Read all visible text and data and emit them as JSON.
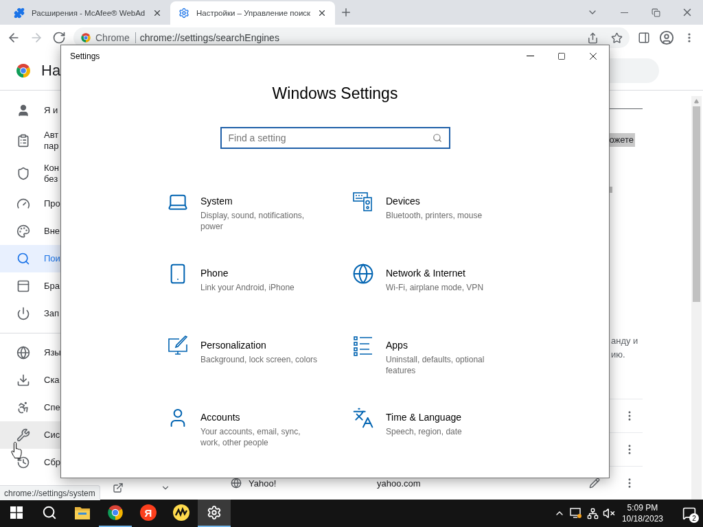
{
  "browser": {
    "tabs": [
      {
        "kind": "puzzle",
        "title": "Расширения - McAfee® WebAd",
        "selected": false
      },
      {
        "kind": "gear",
        "title": "Настройки – Управление поиск",
        "selected": true
      }
    ],
    "nav": [
      {
        "kind": "back",
        "disabled": false
      },
      {
        "kind": "forward",
        "disabled": true
      },
      {
        "kind": "reload",
        "disabled": false
      }
    ],
    "omnibox": {
      "chip": "Chrome",
      "url": "chrome://settings/searchEngines"
    }
  },
  "page": {
    "header_title": "На",
    "sidebar": [
      {
        "items": [
          {
            "kind": "person",
            "lines": [
              "Я и"
            ],
            "selected": false,
            "hovered": false
          },
          {
            "kind": "clipboard",
            "lines": [
              "Авт",
              "пар"
            ],
            "selected": false,
            "hovered": false
          },
          {
            "kind": "shield",
            "lines": [
              "Кон",
              "без"
            ],
            "selected": false,
            "hovered": false
          },
          {
            "kind": "gauge",
            "lines": [
              "Про"
            ],
            "selected": false,
            "hovered": false
          },
          {
            "kind": "palette",
            "lines": [
              "Вне"
            ],
            "selected": false,
            "hovered": false
          },
          {
            "kind": "search",
            "lines": [
              "Пои"
            ],
            "selected": true,
            "hovered": false
          },
          {
            "kind": "browser",
            "lines": [
              "Бра"
            ],
            "selected": false,
            "hovered": false
          },
          {
            "kind": "power",
            "lines": [
              "Зап"
            ],
            "selected": false,
            "hovered": false
          }
        ]
      },
      {
        "items": [
          {
            "kind": "globe",
            "lines": [
              "Язы"
            ],
            "selected": false,
            "hovered": false
          },
          {
            "kind": "download",
            "lines": [
              "Ска"
            ],
            "selected": false,
            "hovered": false
          },
          {
            "kind": "accessibility",
            "lines": [
              "Спе"
            ],
            "selected": false,
            "hovered": false
          },
          {
            "kind": "wrench",
            "lines": [
              "Сис"
            ],
            "selected": false,
            "hovered": true
          },
          {
            "kind": "history",
            "lines": [
              "Сбр"
            ],
            "selected": false,
            "hovered": false
          }
        ]
      }
    ],
    "highlight": "ожете",
    "paragraph_lines": [
      "анду и",
      "ию."
    ],
    "engines": [
      {
        "name": "Yahoo!",
        "keyword": "yahoo.com"
      }
    ],
    "status_url": "chrome://settings/system"
  },
  "settings_window": {
    "title": "Settings",
    "heading": "Windows Settings",
    "search_placeholder": "Find a setting",
    "categories": [
      {
        "kind": "laptop",
        "title": "System",
        "description": "Display, sound, notifications, power"
      },
      {
        "kind": "devices",
        "title": "Devices",
        "description": "Bluetooth, printers, mouse"
      },
      {
        "kind": "phone",
        "title": "Phone",
        "description": "Link your Android, iPhone"
      },
      {
        "kind": "globe",
        "title": "Network & Internet",
        "description": "Wi-Fi, airplane mode, VPN"
      },
      {
        "kind": "personalization",
        "title": "Personalization",
        "description": "Background, lock screen, colors"
      },
      {
        "kind": "apps",
        "title": "Apps",
        "description": "Uninstall, defaults, optional features"
      },
      {
        "kind": "accounts",
        "title": "Accounts",
        "description": "Your accounts, email, sync, work, other people"
      },
      {
        "kind": "time-language",
        "title": "Time & Language",
        "description": "Speech, region, date"
      }
    ]
  },
  "taskbar": {
    "apps": [
      {
        "kind": "explorer",
        "running": false,
        "selected": false
      },
      {
        "kind": "chrome",
        "running": true,
        "selected": false
      },
      {
        "kind": "yandex",
        "label": "Я",
        "running": false,
        "selected": false
      },
      {
        "kind": "yandex-music",
        "running": false,
        "selected": false
      },
      {
        "kind": "settings",
        "running": true,
        "selected": true
      }
    ],
    "time": "5:09 PM",
    "date": "10/18/2023",
    "notifications": "2"
  }
}
